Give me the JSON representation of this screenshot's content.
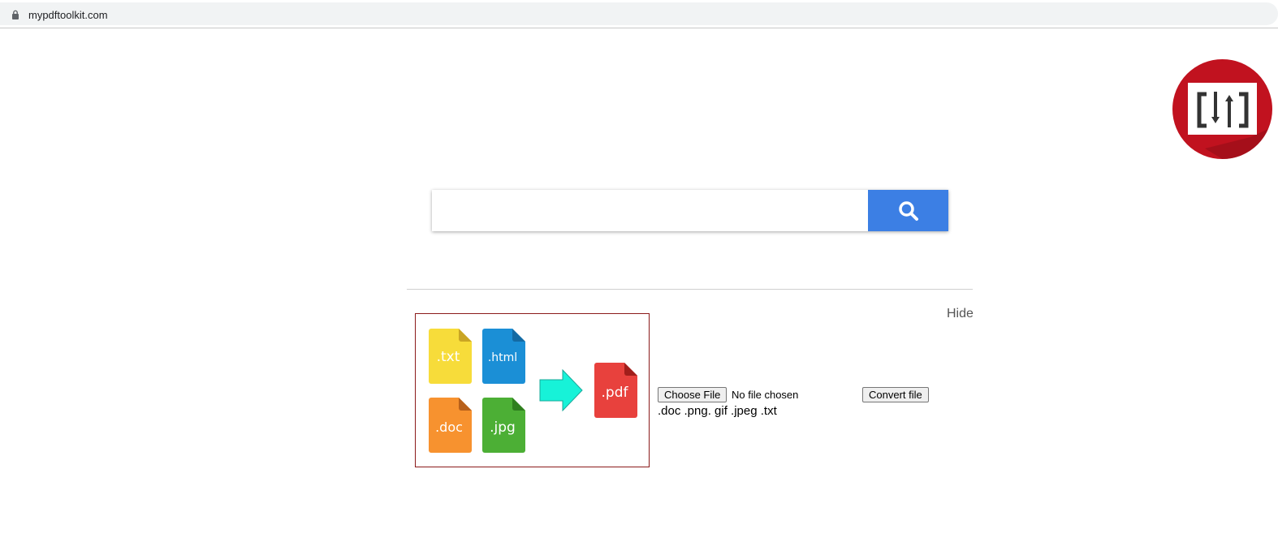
{
  "browser": {
    "url": "mypdftoolkit.com"
  },
  "search": {
    "placeholder": "",
    "value": "",
    "button_icon": "search-icon",
    "button_color": "#3c7fe4"
  },
  "widget": {
    "hide_label": "Hide",
    "illustration": {
      "input_types": [
        ".txt",
        ".html",
        ".doc",
        ".jpg"
      ],
      "output_type": ".pdf",
      "border_color": "#8b1a1a"
    },
    "choose_file_label": "Choose File",
    "file_status": "No file chosen",
    "convert_label": "Convert file",
    "supported_formats": ".doc .png. gif .jpeg .txt"
  },
  "logo": {
    "icon": "convert-logo-icon",
    "color": "#c1121f"
  }
}
